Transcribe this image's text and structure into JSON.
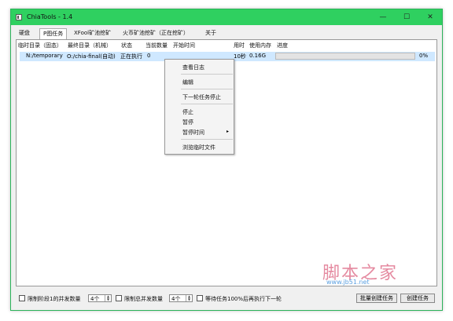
{
  "window": {
    "title": "ChiaTools - 1.4",
    "minimize": "—",
    "maximize": "☐",
    "close": "✕"
  },
  "tabs": [
    "硬盘",
    "P图任务",
    "XFool矿池挖矿",
    "火币矿池挖矿（正在挖矿）",
    "关于"
  ],
  "table": {
    "headers": [
      "临时目录（固态）",
      "最终目录（机械）",
      "状态",
      "当前数量",
      "开始时间",
      "用时",
      "使用内存",
      "进度"
    ],
    "row": {
      "temp": "N:/temporary",
      "final": "O:/chia-final(自动)",
      "status": "正在执行",
      "count": "0",
      "start": "",
      "elapsed": "10秒",
      "memory": "0.16G",
      "progress_pct": 0,
      "progress_text": "0%"
    }
  },
  "context_menu": [
    "查看日志",
    "编辑",
    "下一轮任务停止",
    "停止",
    "暂停",
    "暂停时间",
    "浏览临时文件"
  ],
  "bottom": {
    "limit_phase1": "限制阶段1的并发数量",
    "spin1": "4个",
    "limit_total": "限制总并发数量",
    "spin2": "4个",
    "wait_label": "等待任务100%后再执行下一轮",
    "batch_btn": "批量创建任务",
    "create_btn": "创建任务"
  },
  "watermark": {
    "text": "脚本之家",
    "url": "www.jb51.net"
  }
}
